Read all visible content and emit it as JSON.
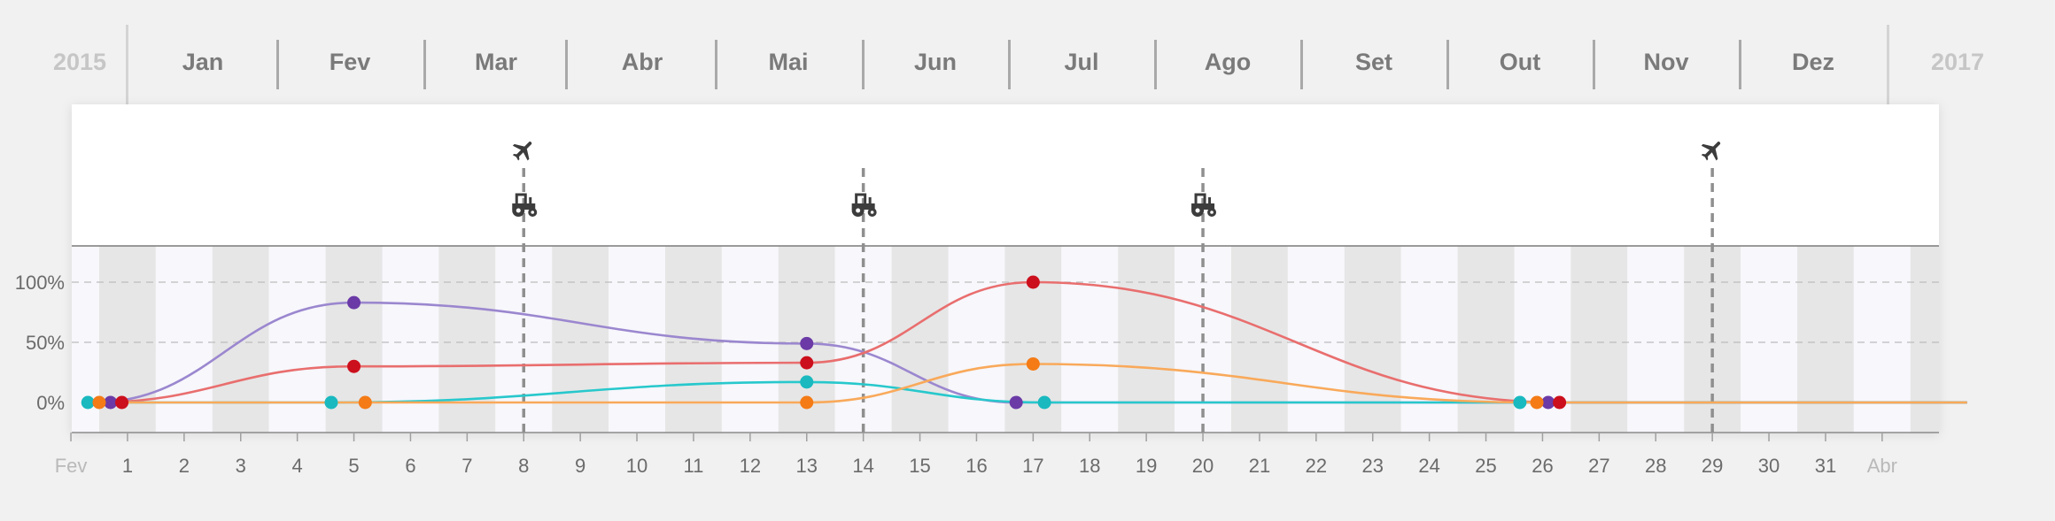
{
  "timeline": {
    "prev_year": "2015",
    "next_year": "2017",
    "months": [
      "Jan",
      "Fev",
      "Mar",
      "Abr",
      "Mai",
      "Jun",
      "Jul",
      "Ago",
      "Set",
      "Out",
      "Nov",
      "Dez"
    ]
  },
  "chart_data": {
    "type": "line",
    "x_tick_labels": [
      "Fev",
      "1",
      "2",
      "3",
      "4",
      "5",
      "6",
      "7",
      "8",
      "9",
      "10",
      "11",
      "12",
      "13",
      "14",
      "15",
      "16",
      "17",
      "18",
      "19",
      "20",
      "21",
      "22",
      "23",
      "24",
      "25",
      "26",
      "27",
      "28",
      "29",
      "30",
      "31",
      "Abr"
    ],
    "y_tick_labels": [
      "100%",
      "50%",
      "0%"
    ],
    "ylim": [
      -25,
      125
    ],
    "grid": true,
    "series": [
      {
        "color": "#9b87cf",
        "marker": "#6b3aa6",
        "points": [
          [
            -0.6,
            0
          ],
          [
            4,
            83
          ],
          [
            12,
            49
          ],
          [
            15.7,
            0
          ],
          [
            25,
            0
          ],
          [
            32.5,
            0
          ]
        ],
        "markers": [
          [
            -0.3,
            0
          ],
          [
            4,
            83
          ],
          [
            12,
            49
          ],
          [
            15.7,
            0
          ],
          [
            25.1,
            0
          ]
        ]
      },
      {
        "color": "#e96e6e",
        "marker": "#cc0f1c",
        "points": [
          [
            -0.6,
            0
          ],
          [
            4,
            30
          ],
          [
            12,
            33
          ],
          [
            16,
            100
          ],
          [
            25.3,
            0
          ],
          [
            32.5,
            0
          ]
        ],
        "markers": [
          [
            -0.1,
            0
          ],
          [
            4,
            30
          ],
          [
            12,
            33
          ],
          [
            16,
            100
          ],
          [
            25.3,
            0
          ]
        ]
      },
      {
        "color": "#27c8cc",
        "marker": "#19b9bf",
        "points": [
          [
            -0.6,
            0
          ],
          [
            3.6,
            0
          ],
          [
            12,
            17
          ],
          [
            16.2,
            0
          ],
          [
            24.6,
            0
          ],
          [
            32.5,
            0
          ]
        ],
        "markers": [
          [
            -0.7,
            0
          ],
          [
            3.6,
            0
          ],
          [
            12,
            17
          ],
          [
            16.2,
            0
          ],
          [
            24.6,
            0
          ]
        ]
      },
      {
        "color": "#f9a95a",
        "marker": "#f47b16",
        "points": [
          [
            -0.6,
            0
          ],
          [
            4.2,
            0
          ],
          [
            12,
            0
          ],
          [
            16,
            32
          ],
          [
            24.9,
            0
          ],
          [
            32.5,
            0
          ]
        ],
        "markers": [
          [
            -0.5,
            0
          ],
          [
            4.2,
            0
          ],
          [
            12,
            0
          ],
          [
            16,
            32
          ],
          [
            24.9,
            0
          ]
        ]
      }
    ],
    "events": [
      {
        "x": 7,
        "icons": [
          "plane-icon",
          "tractor-icon"
        ]
      },
      {
        "x": 13,
        "icons": [
          "tractor-icon"
        ]
      },
      {
        "x": 19,
        "icons": [
          "tractor-icon"
        ]
      },
      {
        "x": 28,
        "icons": [
          "plane-icon"
        ]
      }
    ]
  }
}
